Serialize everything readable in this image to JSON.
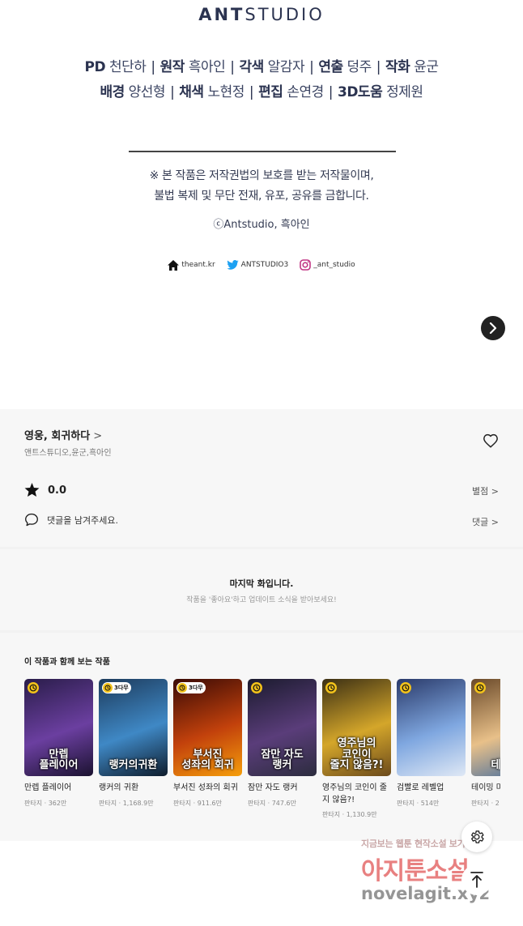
{
  "logo": {
    "bold": "ANT",
    "thin": "STUDIO"
  },
  "staff": {
    "line1": [
      {
        "role": "PD",
        "name": "천단하"
      },
      {
        "role": "원작",
        "name": "흑아인"
      },
      {
        "role": "각색",
        "name": "알감자"
      },
      {
        "role": "연출",
        "name": "덩주"
      },
      {
        "role": "작화",
        "name": "윤군"
      }
    ],
    "line2": [
      {
        "role": "배경",
        "name": "양선형"
      },
      {
        "role": "채색",
        "name": "노현정"
      },
      {
        "role": "편집",
        "name": "손연경"
      },
      {
        "role": "3D도움",
        "name": "정제원"
      }
    ],
    "separator": "|"
  },
  "notice": {
    "line1": "※ 본 작품은 저작권법의 보호를 받는 저작물이며,",
    "line2": "불법 복제 및 무단 전재, 유포, 공유를 금합니다.",
    "copyright": "ⓒAntstudio, 흑아인"
  },
  "social": {
    "home": "theant.kr",
    "twitter": "ANTSTUDIO3",
    "instagram": "_ant_studio"
  },
  "series": {
    "title": "영웅, 회귀하다",
    "chevron": ">",
    "authors": "앤트스튜디오,윤군,흑아인",
    "rating": "0.0",
    "rating_link": "별점 >",
    "comment_placeholder": "댓글을 남겨주세요.",
    "comment_link": "댓글 >"
  },
  "last_episode": {
    "title": "마지막 화입니다.",
    "subtitle": "작품을 '좋아요'하고 업데이트 소식을 받아보세요!"
  },
  "recommendations": {
    "title": "이 작품과 함께 보는 작품",
    "badge_3": "3다무",
    "items": [
      {
        "name": "만렙 플레이어",
        "meta": "판타지 · 362만",
        "cover": "만렙\n플레이어",
        "badge": "clock",
        "colors": [
          "#2a1d4a",
          "#6b3fa0",
          "#1b1230"
        ]
      },
      {
        "name": "랭커의 귀환",
        "meta": "판타지 · 1,168.9만",
        "cover": "랭커의귀환",
        "badge": "3",
        "colors": [
          "#1d3b5c",
          "#3f88c5",
          "#0e1c2c"
        ]
      },
      {
        "name": "부서진 성좌의 회귀",
        "meta": "판타지 · 911.6만",
        "cover": "부서진\n성좌의 회귀",
        "badge": "3",
        "colors": [
          "#3a0a05",
          "#c2410c",
          "#f59e0b"
        ]
      },
      {
        "name": "잠만 자도 랭커",
        "meta": "판타지 · 747.6만",
        "cover": "잠만 자도\n랭커",
        "badge": "clock",
        "colors": [
          "#1b1b2e",
          "#5a3d7a",
          "#2c2c3e"
        ]
      },
      {
        "name": "영주님의 코인이 줄지 않음?!",
        "meta": "판타지 · 1,130.9만",
        "cover": "영주님의\n코인이\n줄지 않음?!",
        "badge": "clock",
        "colors": [
          "#3b2f14",
          "#d4a62a",
          "#6b4a1c"
        ]
      },
      {
        "name": "검빨로 레벨업",
        "meta": "판타지 · 514만",
        "cover": "",
        "badge": "clock",
        "colors": [
          "#2a3a6a",
          "#7fa7e0",
          "#dfe8f5"
        ]
      },
      {
        "name": "테이밍 마스터",
        "meta": "판타지 · 2",
        "cover": "테이밍",
        "badge": "clock",
        "colors": [
          "#6b4a2a",
          "#e8c089",
          "#3f6aa0"
        ]
      }
    ]
  },
  "watermark": {
    "line1": "지금보는 웹툰 현작소설 보기어렵다",
    "line2": "아지툰소설",
    "line3": "novelagit.xyz"
  }
}
